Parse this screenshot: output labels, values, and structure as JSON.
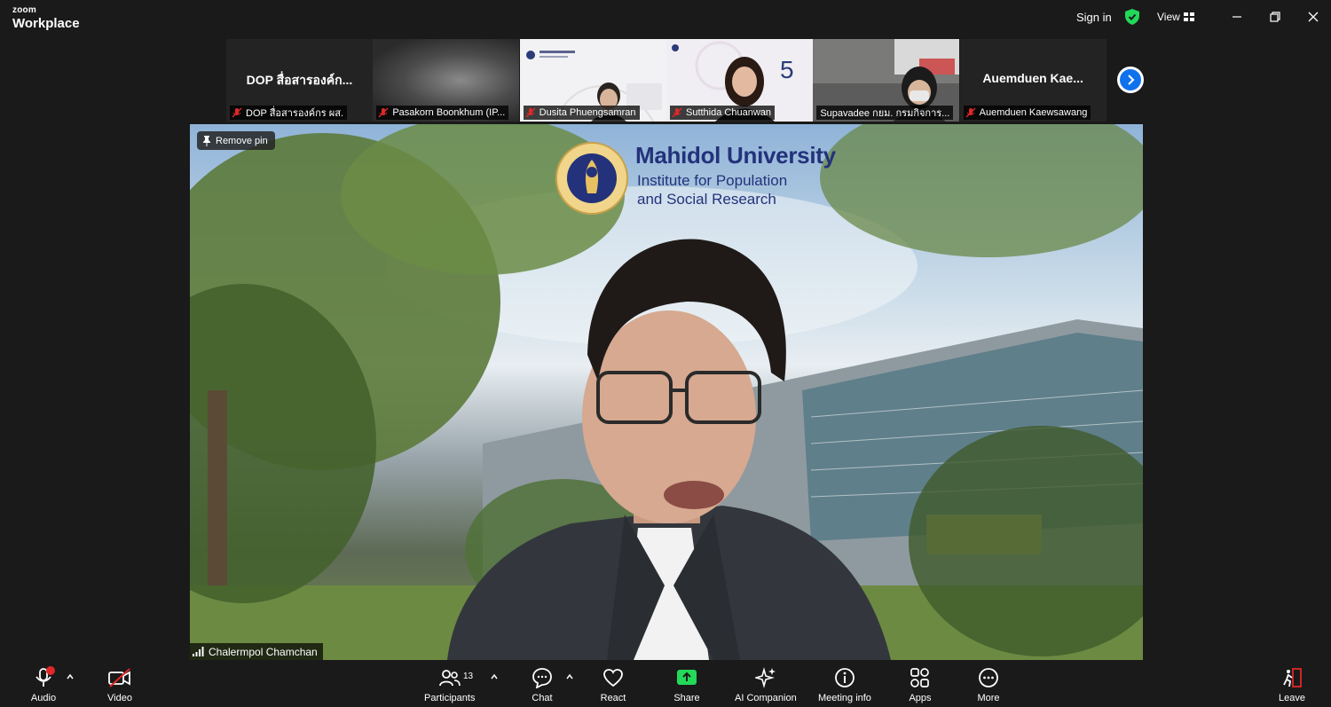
{
  "titlebar": {
    "brand_top": "zoom",
    "brand_bottom": "Workplace",
    "signin": "Sign in",
    "view": "View"
  },
  "thumbnails": [
    {
      "big_name": "DOP สื่อสารองค์ก...",
      "label": "DOP สื่อสารองค์กร ผส.",
      "muted": true,
      "video": false
    },
    {
      "big_name": "",
      "label": "Pasakorn Boonkhum (IP...",
      "muted": true,
      "video": true
    },
    {
      "big_name": "",
      "label": "Dusita Phuengsamran",
      "muted": true,
      "video": true
    },
    {
      "big_name": "",
      "label": "Sutthida Chuanwan",
      "muted": true,
      "video": true
    },
    {
      "big_name": "",
      "label": "Supavadee กยม. กรมกิจการ...",
      "muted": false,
      "video": true
    },
    {
      "big_name": "Auemduen  Kae...",
      "label": "Auemduen Kaewsawang",
      "muted": true,
      "video": false
    }
  ],
  "main": {
    "pin_label": "Remove pin",
    "logo_title": "Mahidol University",
    "logo_line1": "Institute for Population",
    "logo_line2": "and Social Research",
    "speaker": "Chalermpol Chamchan"
  },
  "toolbar": {
    "audio": "Audio",
    "video": "Video",
    "participants": "Participants",
    "participants_count": "13",
    "chat": "Chat",
    "react": "React",
    "share": "Share",
    "ai": "AI Companion",
    "info": "Meeting info",
    "apps": "Apps",
    "more": "More",
    "leave": "Leave"
  },
  "colors": {
    "accent": "#0e72ed",
    "share": "#23d959",
    "danger": "#e02828",
    "shield": "#23d959"
  }
}
